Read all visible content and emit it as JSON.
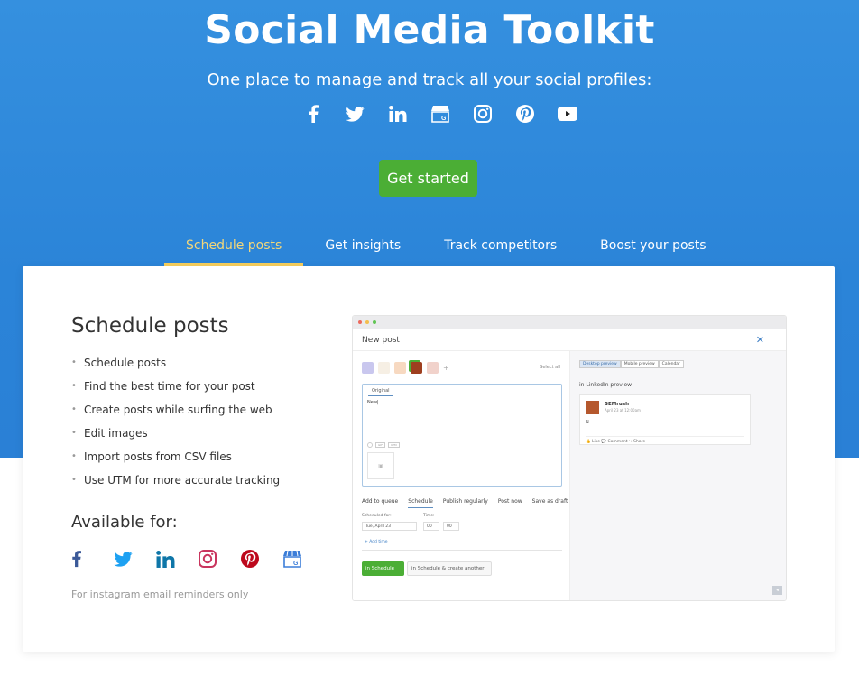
{
  "hero": {
    "title": "Social Media Toolkit",
    "subtitle": "One place to manage and track all your social profiles:",
    "icons": [
      "facebook-icon",
      "twitter-icon",
      "linkedin-icon",
      "google-business-icon",
      "instagram-icon",
      "pinterest-icon",
      "youtube-icon"
    ],
    "cta_label": "Get started",
    "background_color": "#3590df",
    "cta_color": "#4bae35"
  },
  "tabs": [
    {
      "label": "Schedule posts",
      "active": true
    },
    {
      "label": "Get insights",
      "active": false
    },
    {
      "label": "Track competitors",
      "active": false
    },
    {
      "label": "Boost your posts",
      "active": false
    }
  ],
  "section": {
    "title": "Schedule posts",
    "features": [
      "Schedule posts",
      "Find the best time for your post",
      "Create posts while surfing the web",
      "Edit images",
      "Import posts from CSV files",
      "Use UTM for more accurate tracking"
    ],
    "available_title": "Available for:",
    "available_icons": [
      "facebook-icon",
      "twitter-icon",
      "linkedin-icon",
      "instagram-icon",
      "pinterest-icon",
      "google-business-icon"
    ],
    "note": "For instagram email reminders only"
  },
  "mockup": {
    "window_title": "New post",
    "close_glyph": "✕",
    "select_all": "Select all",
    "editor_tab": "Original",
    "editor_text": "New|",
    "editor_tools": [
      "GIF",
      "UTM"
    ],
    "post_tabs": [
      {
        "label": "Add to queue",
        "active": false
      },
      {
        "label": "Schedule",
        "active": true
      },
      {
        "label": "Publish regularly",
        "active": false
      },
      {
        "label": "Post now",
        "active": false
      },
      {
        "label": "Save as draft",
        "active": false
      }
    ],
    "scheduled_for_label": "Scheduled for:",
    "date_value": "Tue, April 23",
    "time_label": "Time:",
    "hour_value": "00",
    "minute_value": "00",
    "add_time": "+ Add time",
    "schedule_button": "in  Schedule",
    "schedule_another_button": "in  Schedule & create another",
    "preview_tabs": [
      {
        "label": "Desktop preview",
        "active": true
      },
      {
        "label": "Mobile preview",
        "active": false
      },
      {
        "label": "Calendar",
        "active": false
      }
    ],
    "preview_title": "in LinkedIn preview",
    "preview_account": "SEMrush",
    "preview_date": "April 23 at 12:00am",
    "preview_text": "N",
    "preview_actions": "👍 Like   💬 Comment   ↪ Share"
  }
}
